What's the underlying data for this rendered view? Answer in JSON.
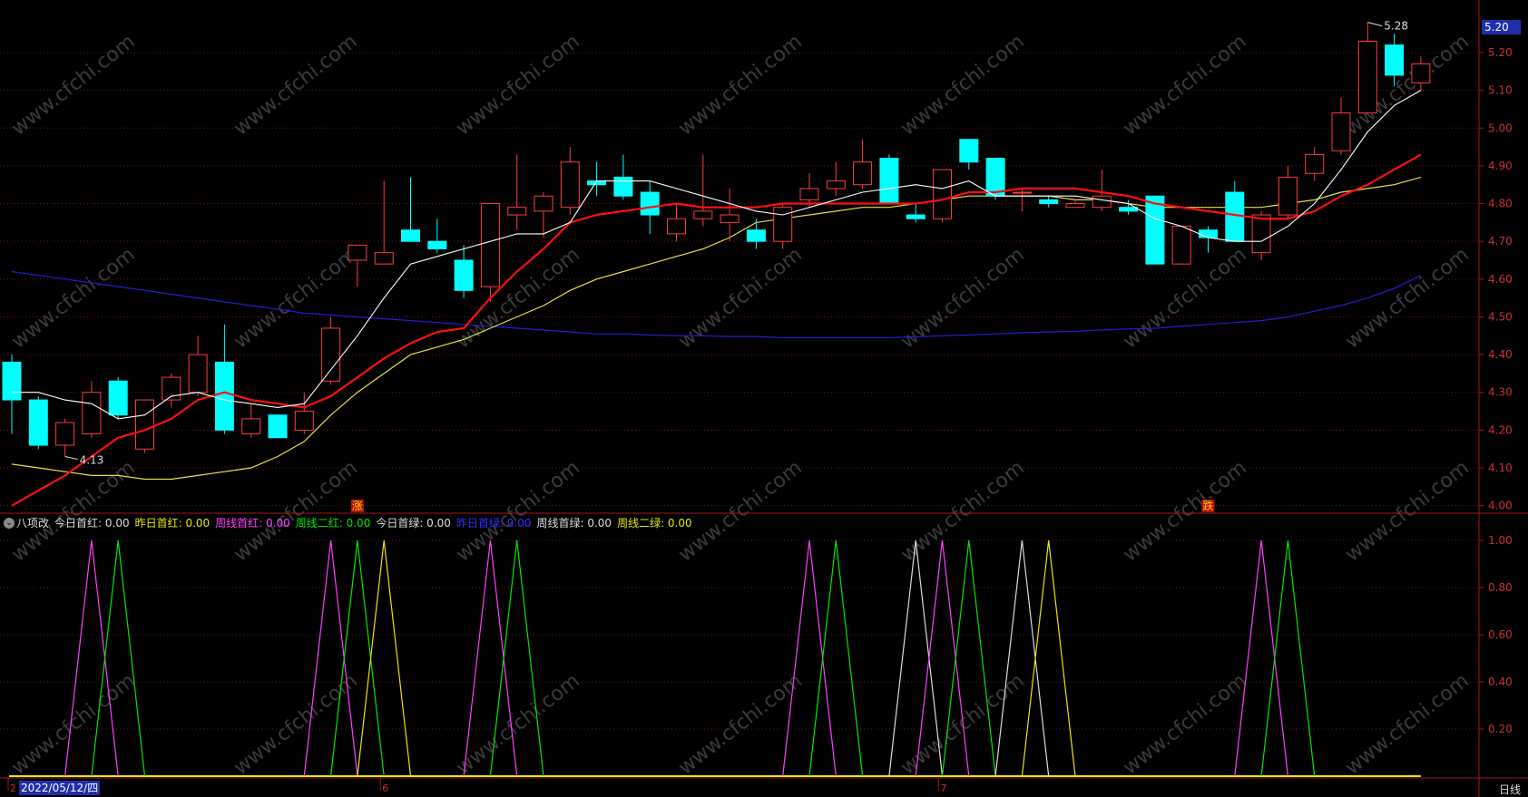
{
  "price_panel": {
    "y_ticks": [
      "5.20",
      "5.10",
      "5.00",
      "4.90",
      "4.80",
      "4.70",
      "4.60",
      "4.50",
      "4.40",
      "4.30",
      "4.20",
      "4.10",
      "4.00"
    ],
    "current_price": "5.20",
    "high_label": "5.28",
    "low_label": "4.13",
    "signal_markers": [
      {
        "text": "涨",
        "bar": 13
      },
      {
        "text": "跌",
        "bar": 45
      }
    ],
    "watermark": "www.cfchi.com"
  },
  "indicator": {
    "name": "八项改",
    "y_ticks": [
      "1.00",
      "0.80",
      "0.60",
      "0.40",
      "0.20"
    ],
    "legend": [
      {
        "label": "今日首红: 0.00",
        "color": "#dcdcdc"
      },
      {
        "label": "昨日首红: 0.00",
        "color": "#e8e800"
      },
      {
        "label": "周线首红: 0.00",
        "color": "#ff40ff"
      },
      {
        "label": "周线二红: 0.00",
        "color": "#00e800"
      },
      {
        "label": "今日首绿: 0.00",
        "color": "#dcdcdc"
      },
      {
        "label": "昨日首绿: 0.00",
        "color": "#3030ff"
      },
      {
        "label": "周线首绿: 0.00",
        "color": "#dcdcdc"
      },
      {
        "label": "周线二绿: 0.00",
        "color": "#e8e800"
      }
    ]
  },
  "axis": {
    "date_label": "2022/05/12/四",
    "month_ticks": [
      {
        "text": "2",
        "bar": 0
      },
      {
        "text": "6",
        "bar": 14
      },
      {
        "text": "7",
        "bar": 35
      }
    ],
    "period": "日线"
  },
  "colors": {
    "up": "#ff3c3c",
    "down": "#00ffff",
    "ma5": "#ffffff",
    "ma10": "#ff1010",
    "ma20": "#e8e040",
    "ma60": "#2020d0",
    "grid": "#7a1010",
    "frame": "#a01818"
  },
  "chart_data": {
    "type": "candlestick",
    "ylim": [
      3.98,
      5.32
    ],
    "candles": [
      [
        4.38,
        4.4,
        4.19,
        4.28
      ],
      [
        4.28,
        4.29,
        4.15,
        4.16
      ],
      [
        4.16,
        4.23,
        4.13,
        4.22
      ],
      [
        4.19,
        4.33,
        4.18,
        4.3
      ],
      [
        4.33,
        4.34,
        4.23,
        4.24
      ],
      [
        4.15,
        4.27,
        4.14,
        4.28
      ],
      [
        4.28,
        4.35,
        4.26,
        4.34
      ],
      [
        4.3,
        4.45,
        4.29,
        4.4
      ],
      [
        4.38,
        4.48,
        4.19,
        4.2
      ],
      [
        4.19,
        4.27,
        4.18,
        4.23
      ],
      [
        4.24,
        4.24,
        4.18,
        4.18
      ],
      [
        4.2,
        4.3,
        4.19,
        4.25
      ],
      [
        4.33,
        4.5,
        4.32,
        4.47
      ],
      [
        4.65,
        4.69,
        4.58,
        4.69
      ],
      [
        4.64,
        4.86,
        4.64,
        4.67
      ],
      [
        4.73,
        4.87,
        4.7,
        4.7
      ],
      [
        4.7,
        4.76,
        4.67,
        4.68
      ],
      [
        4.65,
        4.69,
        4.55,
        4.57
      ],
      [
        4.58,
        4.8,
        4.54,
        4.8
      ],
      [
        4.77,
        4.93,
        4.73,
        4.79
      ],
      [
        4.78,
        4.83,
        4.71,
        4.82
      ],
      [
        4.79,
        4.95,
        4.77,
        4.91
      ],
      [
        4.86,
        4.91,
        4.82,
        4.85
      ],
      [
        4.87,
        4.93,
        4.81,
        4.82
      ],
      [
        4.83,
        4.86,
        4.72,
        4.77
      ],
      [
        4.72,
        4.8,
        4.7,
        4.76
      ],
      [
        4.76,
        4.93,
        4.74,
        4.78
      ],
      [
        4.75,
        4.84,
        4.7,
        4.77
      ],
      [
        4.73,
        4.76,
        4.68,
        4.7
      ],
      [
        4.7,
        4.8,
        4.68,
        4.79
      ],
      [
        4.81,
        4.88,
        4.79,
        4.84
      ],
      [
        4.84,
        4.91,
        4.82,
        4.86
      ],
      [
        4.85,
        4.97,
        4.84,
        4.91
      ],
      [
        4.92,
        4.93,
        4.8,
        4.8
      ],
      [
        4.77,
        4.8,
        4.75,
        4.76
      ],
      [
        4.76,
        4.89,
        4.75,
        4.89
      ],
      [
        4.97,
        4.97,
        4.89,
        4.91
      ],
      [
        4.92,
        4.92,
        4.81,
        4.82
      ],
      [
        4.83,
        4.84,
        4.78,
        4.83
      ],
      [
        4.81,
        4.82,
        4.79,
        4.8
      ],
      [
        4.79,
        4.81,
        4.79,
        4.8
      ],
      [
        4.79,
        4.89,
        4.78,
        4.82
      ],
      [
        4.79,
        4.81,
        4.77,
        4.78
      ],
      [
        4.82,
        4.82,
        4.64,
        4.64
      ],
      [
        4.64,
        4.74,
        4.64,
        4.74
      ],
      [
        4.73,
        4.74,
        4.67,
        4.71
      ],
      [
        4.83,
        4.86,
        4.7,
        4.7
      ],
      [
        4.67,
        4.78,
        4.65,
        4.77
      ],
      [
        4.77,
        4.9,
        4.76,
        4.87
      ],
      [
        4.88,
        4.95,
        4.86,
        4.93
      ],
      [
        4.94,
        5.08,
        4.93,
        5.04
      ],
      [
        5.04,
        5.28,
        5.04,
        5.23
      ],
      [
        5.22,
        5.25,
        5.11,
        5.14
      ],
      [
        5.12,
        5.19,
        5.1,
        5.17
      ]
    ],
    "ma5": [
      4.3,
      4.3,
      4.28,
      4.27,
      4.23,
      4.24,
      4.29,
      4.3,
      4.28,
      4.27,
      4.26,
      4.27,
      4.36,
      4.45,
      4.55,
      4.64,
      4.66,
      4.68,
      4.7,
      4.72,
      4.72,
      4.75,
      4.86,
      4.86,
      4.86,
      4.84,
      4.82,
      4.8,
      4.78,
      4.77,
      4.79,
      4.81,
      4.83,
      4.84,
      4.85,
      4.84,
      4.86,
      4.82,
      4.82,
      4.82,
      4.82,
      4.81,
      4.8,
      4.76,
      4.74,
      4.71,
      4.7,
      4.7,
      4.74,
      4.8,
      4.89,
      4.99,
      5.06,
      5.1
    ],
    "ma10": [
      4.0,
      4.04,
      4.08,
      4.13,
      4.18,
      4.2,
      4.23,
      4.28,
      4.3,
      4.28,
      4.27,
      4.26,
      4.29,
      4.34,
      4.39,
      4.43,
      4.46,
      4.47,
      4.55,
      4.62,
      4.68,
      4.75,
      4.77,
      4.78,
      4.79,
      4.8,
      4.79,
      4.79,
      4.79,
      4.8,
      4.8,
      4.8,
      4.8,
      4.8,
      4.8,
      4.81,
      4.83,
      4.83,
      4.84,
      4.84,
      4.84,
      4.83,
      4.82,
      4.8,
      4.79,
      4.78,
      4.77,
      4.76,
      4.76,
      4.78,
      4.82,
      4.85,
      4.89,
      4.93
    ],
    "ma20": [
      4.11,
      4.1,
      4.09,
      4.08,
      4.08,
      4.07,
      4.07,
      4.08,
      4.09,
      4.1,
      4.13,
      4.17,
      4.24,
      4.3,
      4.35,
      4.4,
      4.42,
      4.44,
      4.47,
      4.5,
      4.53,
      4.57,
      4.6,
      4.62,
      4.64,
      4.66,
      4.68,
      4.71,
      4.75,
      4.76,
      4.77,
      4.78,
      4.79,
      4.79,
      4.8,
      4.81,
      4.82,
      4.82,
      4.82,
      4.82,
      4.81,
      4.81,
      4.8,
      4.79,
      4.79,
      4.79,
      4.79,
      4.79,
      4.8,
      4.81,
      4.83,
      4.84,
      4.85,
      4.87
    ],
    "ma60": [
      4.62,
      4.61,
      4.6,
      4.59,
      4.58,
      4.57,
      4.56,
      4.55,
      4.54,
      4.53,
      4.52,
      4.51,
      4.505,
      4.5,
      4.495,
      4.49,
      4.485,
      4.48,
      4.475,
      4.47,
      4.465,
      4.46,
      4.455,
      4.455,
      4.452,
      4.45,
      4.45,
      4.448,
      4.448,
      4.445,
      4.445,
      4.445,
      4.445,
      4.445,
      4.447,
      4.45,
      4.452,
      4.455,
      4.458,
      4.46,
      4.462,
      4.465,
      4.468,
      4.47,
      4.475,
      4.48,
      4.485,
      4.49,
      4.5,
      4.515,
      4.53,
      4.55,
      4.575,
      4.61
    ],
    "indicator_peaks": [
      {
        "bar": 3,
        "color": "#ff40ff"
      },
      {
        "bar": 4,
        "color": "#00e800"
      },
      {
        "bar": 12,
        "color": "#ff40ff"
      },
      {
        "bar": 13,
        "color": "#00e800"
      },
      {
        "bar": 14,
        "color": "#e8e800"
      },
      {
        "bar": 18,
        "color": "#ff40ff"
      },
      {
        "bar": 19,
        "color": "#00e800"
      },
      {
        "bar": 30,
        "color": "#ff40ff"
      },
      {
        "bar": 31,
        "color": "#00e800"
      },
      {
        "bar": 34,
        "color": "#dcdcdc"
      },
      {
        "bar": 35,
        "color": "#ff40ff"
      },
      {
        "bar": 36,
        "color": "#00e800"
      },
      {
        "bar": 38,
        "color": "#dcdcdc"
      },
      {
        "bar": 39,
        "color": "#e8e800"
      },
      {
        "bar": 47,
        "color": "#ff40ff"
      },
      {
        "bar": 48,
        "color": "#00e800"
      }
    ]
  }
}
